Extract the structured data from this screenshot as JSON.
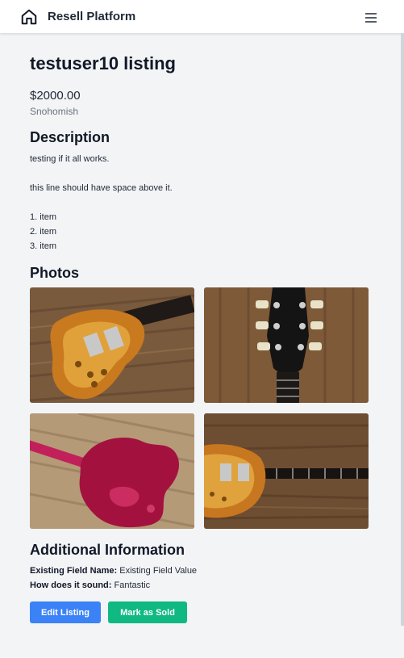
{
  "nav": {
    "brand": "Resell Platform",
    "home_icon": "home-icon",
    "menu_icon": "hamburger-menu-icon"
  },
  "listing": {
    "title": "testuser10 listing",
    "price": "$2000.00",
    "location": "Snohomish"
  },
  "description": {
    "heading": "Description",
    "line1": "testing if it all works.",
    "line2": "this line should have space above it.",
    "items": [
      "1. item",
      "2. item",
      "3. item"
    ]
  },
  "photos": {
    "heading": "Photos",
    "images": [
      "guitar-body-front",
      "guitar-headstock",
      "guitar-body-back",
      "guitar-full-front"
    ]
  },
  "additional": {
    "heading": "Additional Information",
    "fields": [
      {
        "label": "Existing Field Name:",
        "value": "Existing Field Value"
      },
      {
        "label": "How does it sound:",
        "value": "Fantastic"
      }
    ]
  },
  "actions": {
    "edit_label": "Edit Listing",
    "sold_label": "Mark as Sold"
  },
  "colors": {
    "edit_button": "#3b82f6",
    "sold_button": "#10b981",
    "background": "#f3f4f6"
  }
}
